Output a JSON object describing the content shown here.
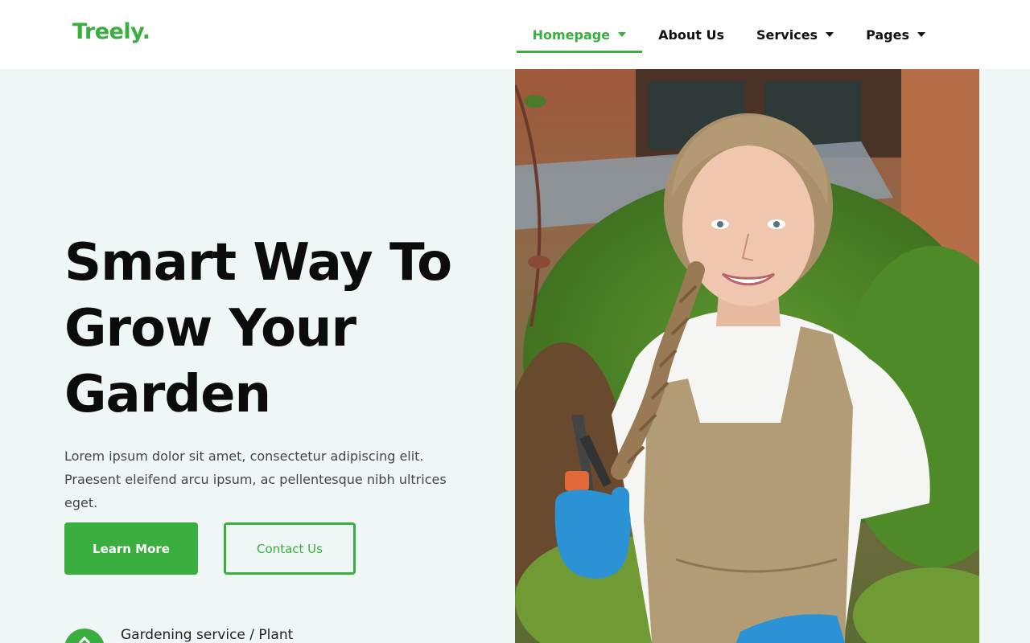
{
  "brand": {
    "name": "Treely",
    "dot": ".",
    "accent_color": "#3aae3f"
  },
  "nav": {
    "items": [
      {
        "label": "Homepage",
        "active": true,
        "has_dropdown": true
      },
      {
        "label": "About Us",
        "active": false,
        "has_dropdown": false
      },
      {
        "label": "Services",
        "active": false,
        "has_dropdown": true
      },
      {
        "label": "Pages",
        "active": false,
        "has_dropdown": true
      }
    ]
  },
  "hero": {
    "title_line1": "Smart Way To",
    "title_line2": "Grow Your",
    "title_line3": "Garden",
    "description": "Lorem ipsum dolor sit amet, consectetur adipiscing elit. Praesent eleifend arcu ipsum, ac pellentesque nibh ultrices eget.",
    "primary_button": "Learn More",
    "secondary_button": "Contact Us",
    "feature_label": "Gardening service / Plant",
    "photo_subject": "gardener-woman-with-pruning-shears"
  }
}
